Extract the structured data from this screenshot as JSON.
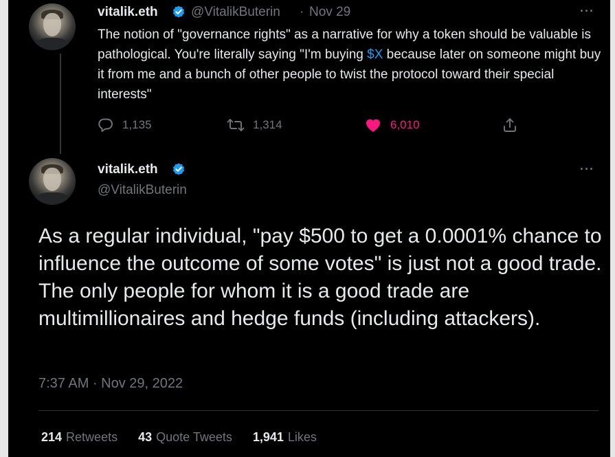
{
  "reply_tweet": {
    "display_name": "vitalik.eth",
    "handle": "@VitalikButerin",
    "separator": "·",
    "date": "Nov 29",
    "text_part1": "The notion of \"governance rights\" as a narrative for why a token should be valuable is pathological. You're literally saying \"I'm buying ",
    "cashtag": "$X",
    "text_part2": " because later on someone might buy it from me and a bunch of other people to twist the protocol toward their special interests\"",
    "replies": "1,135",
    "retweets": "1,314",
    "likes": "6,010",
    "more_label": "···"
  },
  "main_tweet": {
    "display_name": "vitalik.eth",
    "handle": "@VitalikButerin",
    "more_label": "···",
    "text": "As a regular individual, \"pay $500 to get a 0.0001% chance to influence the outcome of some votes\" is just not a good trade. The only people for whom it is a good trade are multimillionaires and hedge funds (including attackers).",
    "timestamp": "7:37 AM · Nov 29, 2022",
    "stats": {
      "retweets_count": "214",
      "retweets_label": "Retweets",
      "quotes_count": "43",
      "quotes_label": "Quote Tweets",
      "likes_count": "1,941",
      "likes_label": "Likes"
    }
  },
  "colors": {
    "background": "#000000",
    "text": "#e7e9ea",
    "muted": "#71767b",
    "link": "#1d9bf0",
    "like": "#f91880",
    "verified": "#1d9bf0"
  },
  "icons": [
    "verified-badge-icon",
    "reply-icon",
    "retweet-icon",
    "heart-icon",
    "share-icon",
    "more-icon"
  ]
}
